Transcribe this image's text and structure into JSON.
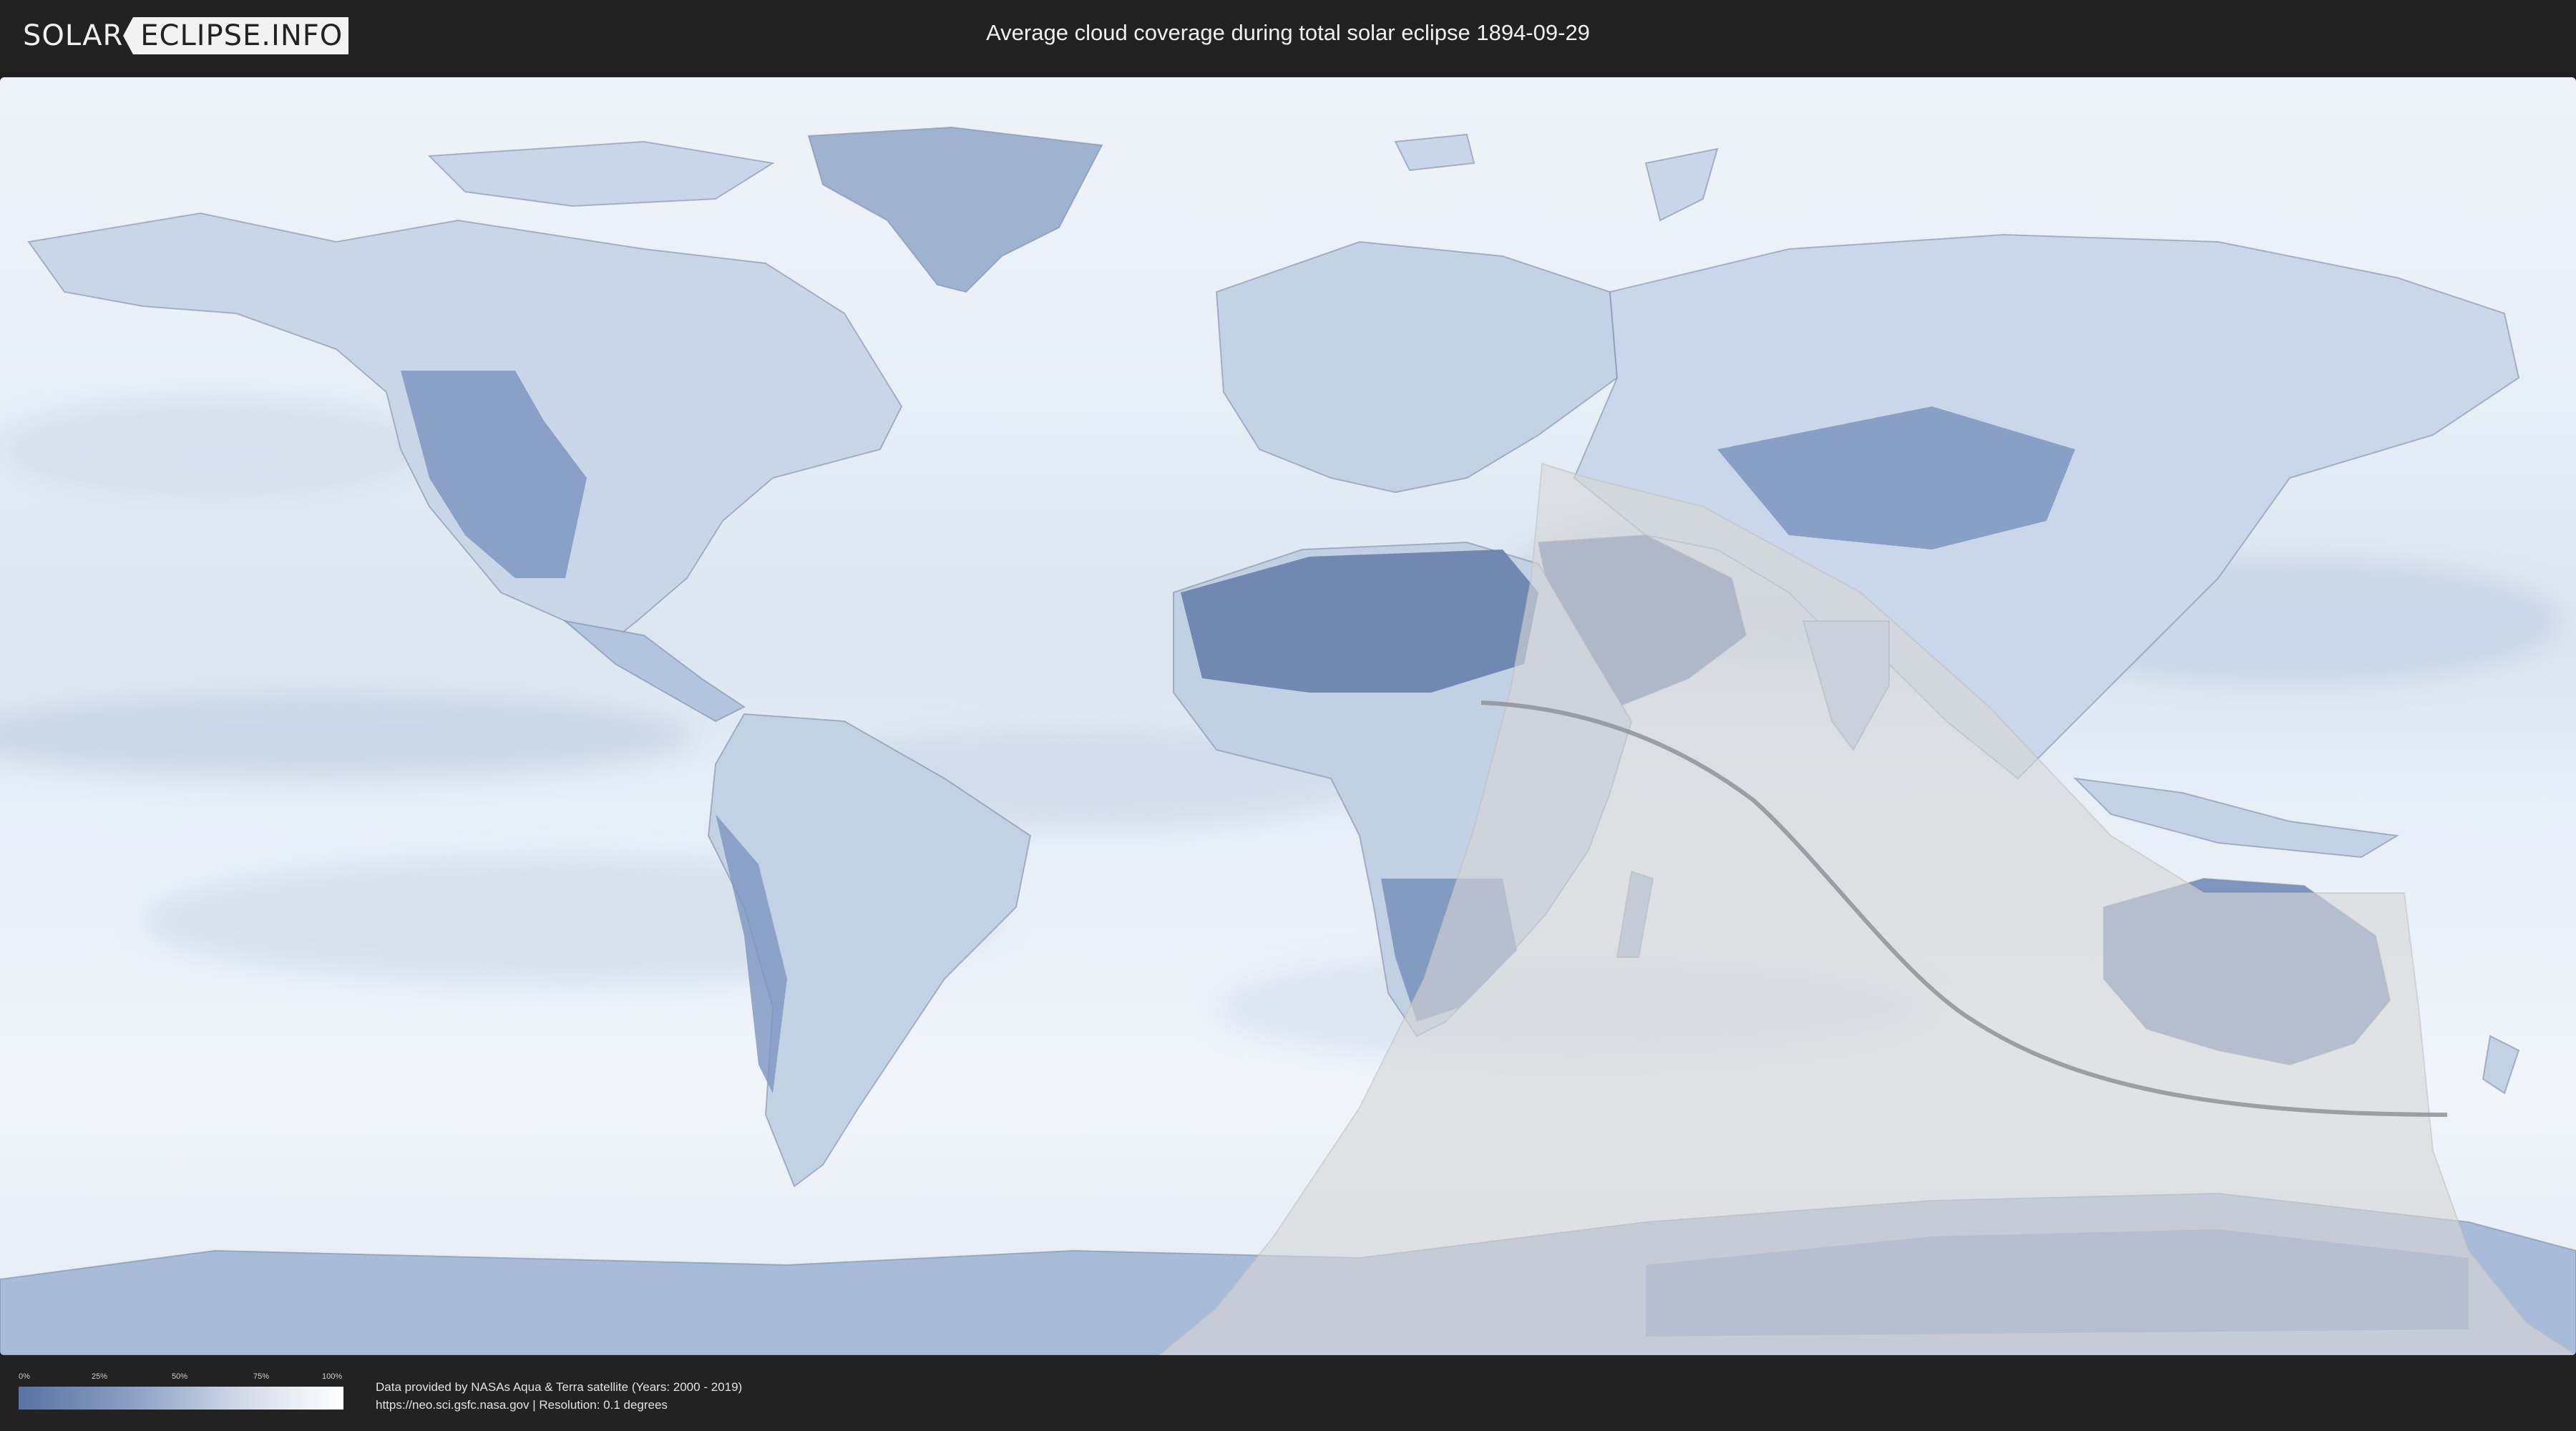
{
  "header": {
    "logo_left": "SOLAR",
    "logo_right": "ECLIPSE.INFO",
    "title": "Average cloud coverage during total solar eclipse 1894-09-29"
  },
  "legend": {
    "ticks": [
      "0%",
      "25%",
      "50%",
      "75%",
      "100%"
    ],
    "gradient_colors": [
      "#5873a3",
      "#8aa0c4",
      "#d4dce9",
      "#ffffff"
    ]
  },
  "credits": {
    "line1": "Data provided by NASAs Aqua & Terra satellite (Years: 2000 - 2019)",
    "line2": "https://neo.sci.gsfc.nasa.gov | Resolution: 0.1 degrees"
  },
  "map": {
    "projection": "equirectangular",
    "ocean_color": "#e4ecf5",
    "land_low_cloud_color": "#6f86b0",
    "eclipse_overlay_color": "#cfcfcf",
    "central_line_color": "#8a8f94"
  }
}
